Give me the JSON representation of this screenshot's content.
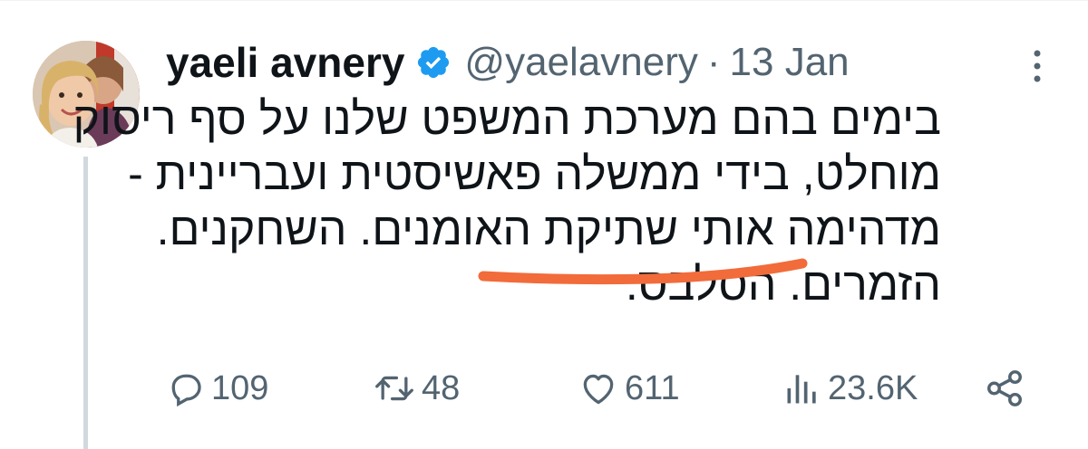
{
  "tweet": {
    "author_name": "yaeli avnery",
    "handle": "@yaelavnery",
    "separator": "·",
    "date": "13 Jan",
    "text_lines": [
      "בימים בהם מערכת המשפט שלנו על סף ריסוק",
      "מוחלט, בידי ממשלה פאשיסטית ועבריינית -",
      "מדהימה אותי שתיקת האומנים. השחקנים.",
      "הזמרים. הסלבס."
    ]
  },
  "actions": {
    "replies": "109",
    "retweets": "48",
    "likes": "611",
    "views": "23.6K"
  },
  "icons": {
    "verified": "verified-badge-icon",
    "more": "more-options-icon",
    "reply": "reply-icon",
    "retweet": "retweet-icon",
    "like": "heart-icon",
    "views": "views-icon",
    "share": "share-icon"
  },
  "colors": {
    "verified_blue": "#1d9bf0",
    "secondary_text": "#536471",
    "highlight_underline": "#f26b3a",
    "thread_line": "#cfd9de"
  }
}
